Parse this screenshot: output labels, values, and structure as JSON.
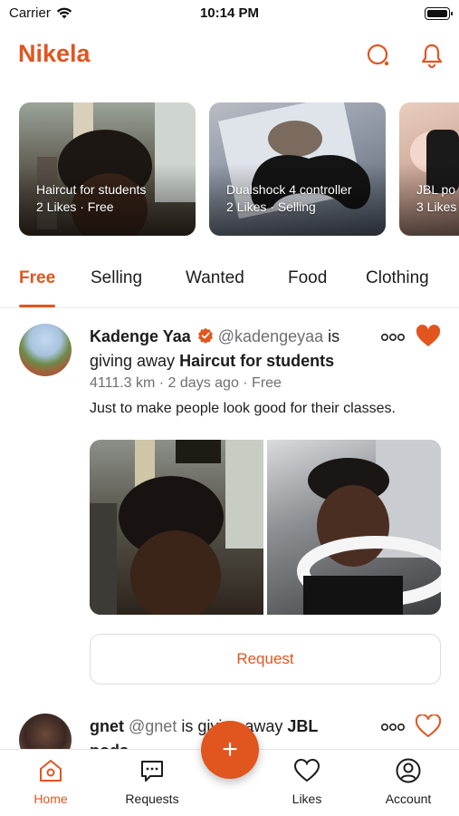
{
  "status_bar": {
    "carrier": "Carrier",
    "time": "10:14 PM"
  },
  "header": {
    "title": "Nikela",
    "search_icon": "search-icon",
    "bell_icon": "bell-icon"
  },
  "colors": {
    "accent": "#e1551f",
    "text": "#1c1c1e",
    "muted": "#6f6f73"
  },
  "featured": [
    {
      "title": "Haircut for students",
      "subtitle": "2 Likes · Free"
    },
    {
      "title": "Dualshock 4 controller",
      "subtitle": "2 Likes · Selling"
    },
    {
      "title": "JBL po",
      "subtitle": "3 Likes"
    }
  ],
  "tabs": [
    {
      "label": "Free",
      "active": true
    },
    {
      "label": "Selling",
      "active": false
    },
    {
      "label": "Wanted",
      "active": false
    },
    {
      "label": "Food",
      "active": false
    },
    {
      "label": "Clothing",
      "active": false
    }
  ],
  "posts": [
    {
      "name": "Kadenge Yaa",
      "handle": "@kadengeyaa",
      "verb": "is",
      "verb2": "giving away",
      "item": "Haircut for students",
      "meta": "4111.3 km · 2 days ago · Free",
      "description": "Just to make people look good for their classes.",
      "liked": true,
      "request_label": "Request"
    },
    {
      "name": "gnet",
      "handle": "@gnet",
      "verb": "is giving away",
      "item": "JBL",
      "line2": "pods",
      "liked": false
    }
  ],
  "fab": {
    "label": "+"
  },
  "bottom_nav": [
    {
      "label": "Home",
      "icon": "home-icon",
      "active": true
    },
    {
      "label": "Requests",
      "icon": "chat-icon",
      "active": false
    },
    {
      "label": "Likes",
      "icon": "heart-icon",
      "active": false
    },
    {
      "label": "Account",
      "icon": "account-icon",
      "active": false
    }
  ]
}
